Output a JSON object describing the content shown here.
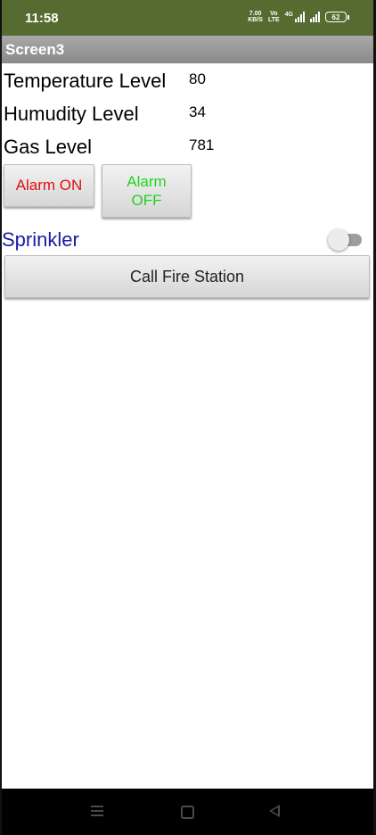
{
  "status_bar": {
    "time": "11:58",
    "net_speed": "7.00",
    "net_unit": "KB/S",
    "volte_top": "Vo",
    "volte_bottom": "LTE",
    "signal_label": "4G",
    "battery": "62",
    "bar_color": "#556b2f"
  },
  "title_bar": {
    "title": "Screen3"
  },
  "readings": {
    "temperature": {
      "label": "Temperature Level",
      "value": "80"
    },
    "humidity": {
      "label": "Humudity Level",
      "value": "34"
    },
    "gas": {
      "label": "Gas Level",
      "value": "781"
    }
  },
  "buttons": {
    "alarm_on": "Alarm ON",
    "alarm_off": "Alarm\nOFF",
    "call_fire_station": "Call Fire Station"
  },
  "sprinkler": {
    "label": "Sprinkler",
    "switch_on": false,
    "label_color": "#1a1aa8"
  },
  "nav_bar": {
    "icons": [
      "menu-icon",
      "home-icon",
      "back-icon"
    ]
  }
}
